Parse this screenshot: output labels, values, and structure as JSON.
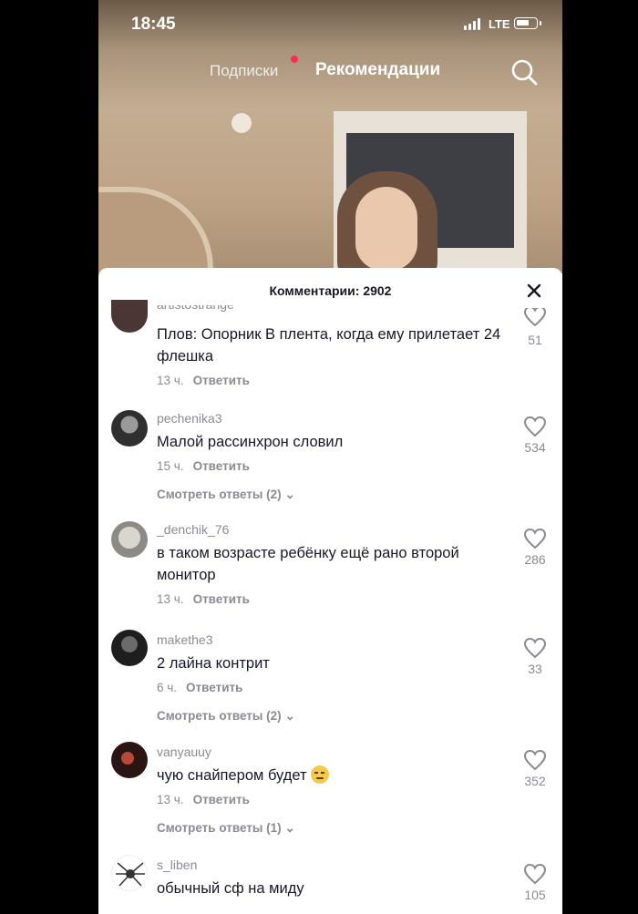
{
  "status_bar": {
    "time": "18:45",
    "network": "LTE",
    "battery_level": 0.7
  },
  "nav": {
    "following": "Подписки",
    "for_you": "Рекомендации"
  },
  "comments_sheet": {
    "title": "Комментарии: 2902",
    "clipped_username": "artistostrange",
    "comments": [
      {
        "username": "",
        "text": "Плов: Опорник В плента, когда ему прилетает 24 флешка",
        "time": "13 ч.",
        "reply": "Ответить",
        "likes": "51",
        "view_replies": ""
      },
      {
        "username": "pechenika3",
        "text": "Малой рассинхрон словил",
        "time": "15 ч.",
        "reply": "Ответить",
        "likes": "534",
        "view_replies": "Смотреть ответы (2)"
      },
      {
        "username": "_denchik_76",
        "text": "в таком возрасте ребёнку ещё рано второй монитор",
        "time": "13 ч.",
        "reply": "Ответить",
        "likes": "286",
        "view_replies": ""
      },
      {
        "username": "makethe3",
        "text": "2 лайна контрит",
        "time": "6 ч.",
        "reply": "Ответить",
        "likes": "33",
        "view_replies": "Смотреть ответы (2)"
      },
      {
        "username": "vanyauuy",
        "text": "чую снайпером будет",
        "time": "13 ч.",
        "reply": "Ответить",
        "likes": "352",
        "view_replies": "Смотреть ответы (1)",
        "emoji": "relieved-face-emoji"
      },
      {
        "username": "s_liben",
        "text": "обычный сф на миду",
        "time": "",
        "reply": "",
        "likes": "105",
        "view_replies": ""
      }
    ]
  }
}
